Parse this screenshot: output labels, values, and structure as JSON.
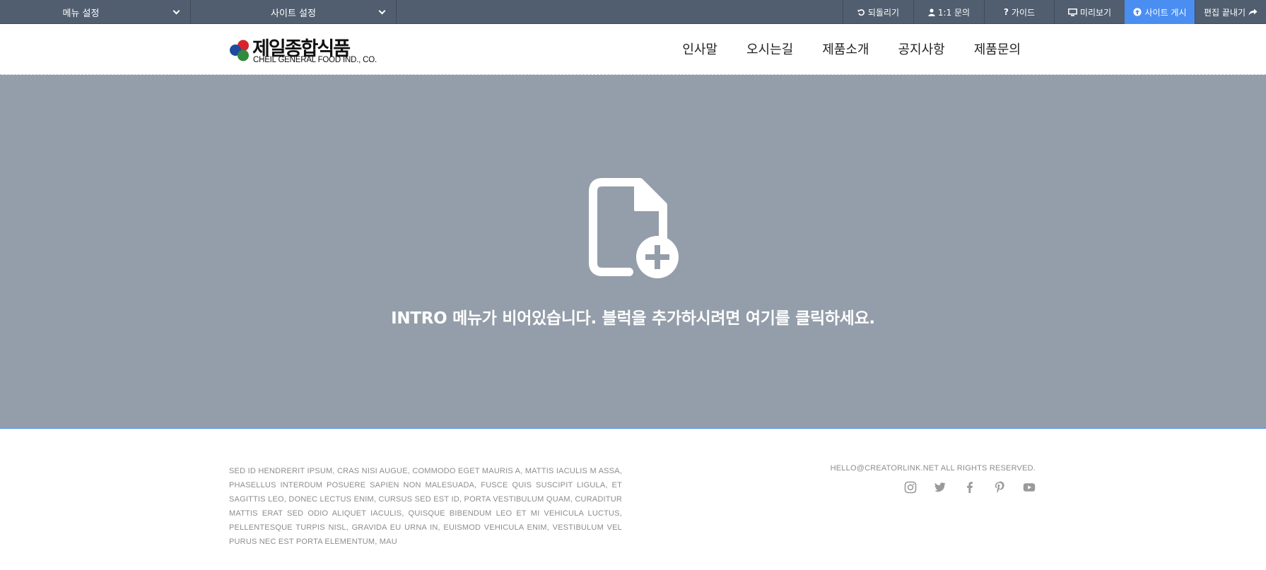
{
  "admin_bar": {
    "menu_select": "메뉴 설정",
    "site_select": "사이트 설정",
    "undo": "되돌리기",
    "qna": "1:1 문의",
    "guide": "가이드",
    "preview": "미리보기",
    "publish": "사이트 게시",
    "finish": "편집 끝내기",
    "publish_color": "#4a8ef1",
    "bar_color": "#515e70"
  },
  "header": {
    "logo_ko": "제일종합식품",
    "logo_en": "CHEIL GENERAL FOOD IND., CO.",
    "nav": [
      "인사말",
      "오시는길",
      "제품소개",
      "공지사항",
      "제품문의"
    ]
  },
  "intro": {
    "icon": "file-add-icon",
    "message": "INTRO 메뉴가 비어있습니다. 블럭을 추가하시려면 여기를 클릭하세요.",
    "background": "#949eaa"
  },
  "footer": {
    "text": "SED ID HENDRERIT IPSUM, CRAS NISI AUGUE, COMMODO EGET MAURIS A, MATTIS IACULIS M ASSA, PHASELLUS INTERDUM POSUERE SAPIEN NON MALESUADA, FUSCE QUIS SUSCIPIT LIGULA, ET SAGITTIS LEO, DONEC LECTUS ENIM, CURSUS SED EST ID, PORTA VESTIBULUM QUAM, CURADITUR MATTIS ERAT SED ODIO ALIQUET IACULIS, QUISQUE BIBENDUM LEO ET MI VEHICULA LUCTUS, PELLENTESQUE TURPIS NISL, GRAVIDA EU URNA IN, EUISMOD VEHICULA ENIM, VESTIBULUM VEL PURUS NEC EST PORTA ELEMENTUM, MAU",
    "copyright": "HELLO@CREATORLINK.NET ALL RIGHTS RESERVED.",
    "social": [
      "instagram-icon",
      "twitter-icon",
      "facebook-icon",
      "pinterest-icon",
      "youtube-icon"
    ]
  }
}
